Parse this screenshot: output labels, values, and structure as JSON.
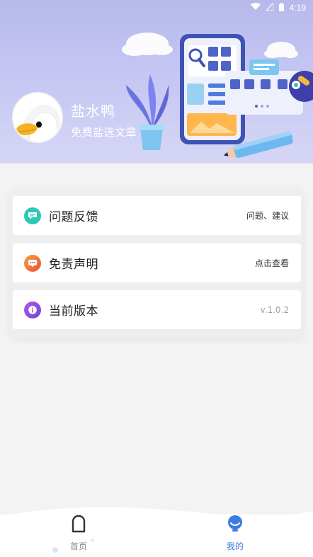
{
  "status_bar": {
    "time": "4:19",
    "icons": [
      "wifi-icon",
      "signal-icon",
      "battery-icon"
    ]
  },
  "profile": {
    "name": "盐水鸭",
    "subtitle": "免费盐选文章",
    "avatar": "duck-avatar"
  },
  "menu": {
    "items": [
      {
        "icon": "feedback-chat-icon",
        "label": "问题反馈",
        "value": "问题、建议",
        "accent": "#2cc7b8"
      },
      {
        "icon": "disclaimer-message-icon",
        "label": "免责声明",
        "value": "点击查看",
        "accent": "#f06a3a"
      },
      {
        "icon": "info-icon",
        "label": "当前版本",
        "value": "v.1.0.2",
        "accent": "#8e4fe0"
      }
    ]
  },
  "bottom_nav": {
    "tabs": [
      {
        "icon": "home-arch-icon",
        "label": "首页",
        "active": false
      },
      {
        "icon": "mine-person-icon",
        "label": "我的",
        "active": true
      }
    ],
    "active_color": "#3d7bdf"
  },
  "colors": {
    "header_gradient_top": "#b7b9ec",
    "header_gradient_bottom": "#d5d6f6",
    "page_background": "#f3f3f4"
  }
}
